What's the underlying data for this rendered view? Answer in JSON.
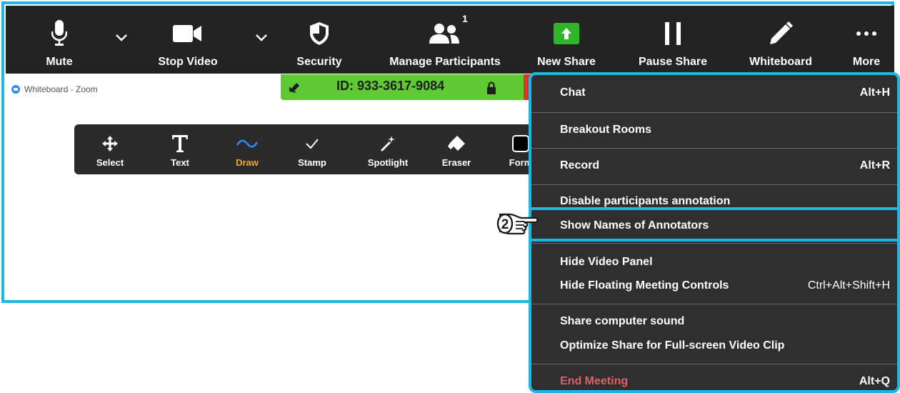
{
  "toolbar": {
    "mute": "Mute",
    "stop_video": "Stop Video",
    "security": "Security",
    "manage_participants": "Manage Participants",
    "participant_count": "1",
    "new_share": "New Share",
    "pause_share": "Pause Share",
    "whiteboard": "Whiteboard",
    "more": "More"
  },
  "window": {
    "title": "Whiteboard - Zoom"
  },
  "meeting": {
    "id_text": "ID: 933-3617-9084"
  },
  "annotation_tools": [
    {
      "label": "Select"
    },
    {
      "label": "Text"
    },
    {
      "label": "Draw"
    },
    {
      "label": "Stamp"
    },
    {
      "label": "Spotlight"
    },
    {
      "label": "Eraser"
    },
    {
      "label": "Form"
    }
  ],
  "menu": {
    "chat": {
      "label": "Chat",
      "shortcut": "Alt+H"
    },
    "breakout_rooms": {
      "label": "Breakout Rooms"
    },
    "record": {
      "label": "Record",
      "shortcut": "Alt+R"
    },
    "disable_annotation": {
      "label": "Disable participants annotation"
    },
    "show_names": {
      "label": "Show Names of Annotators"
    },
    "hide_video_panel": {
      "label": "Hide Video Panel"
    },
    "hide_floating": {
      "label": "Hide Floating Meeting Controls",
      "shortcut": "Ctrl+Alt+Shift+H"
    },
    "share_sound": {
      "label": "Share computer sound"
    },
    "optimize_share": {
      "label": "Optimize Share for Full-screen Video Clip"
    },
    "end_meeting": {
      "label": "End Meeting",
      "shortcut": "Alt+Q"
    }
  },
  "step_marker": "2",
  "colors": {
    "accent_blue": "#1db7e6",
    "toolbar_bg": "#232323",
    "menu_bg": "#2f2f2f",
    "share_green": "#2fb52a",
    "id_bar_green": "#5ec932",
    "end_meeting_red": "#e0616a",
    "draw_active_orange": "#f7a51c"
  }
}
